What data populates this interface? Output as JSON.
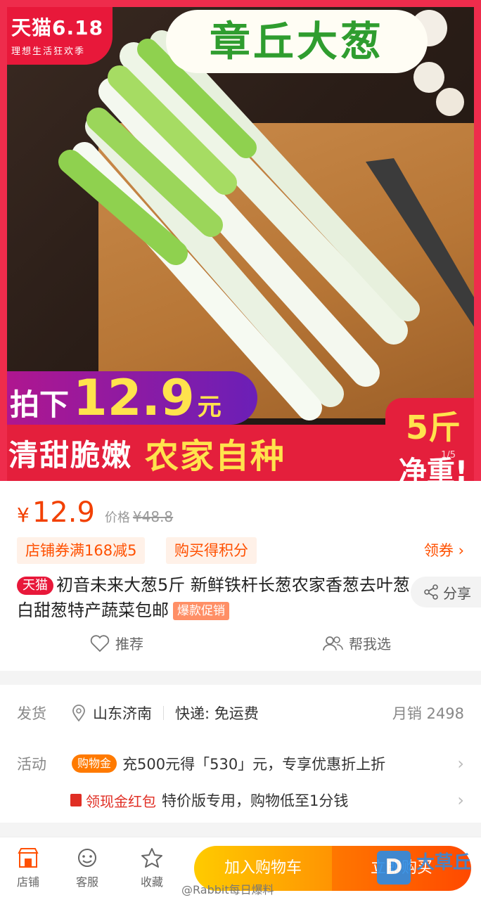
{
  "hero": {
    "badge_brand": "天猫6.18",
    "badge_tag": "理想生活狂欢季",
    "title": "章丘大葱",
    "price_prefix": "拍下",
    "price_value": "12.9",
    "price_unit": "元",
    "slogan_left": "清甜脆嫩",
    "slogan_right": "农家自种",
    "weight_line1": "5斤",
    "weight_line2": "净重!",
    "counter": "1/5"
  },
  "price": {
    "currency": "¥",
    "value": "12.9",
    "orig_label": "价格",
    "orig_value": "¥48.8"
  },
  "coupons": {
    "shop_coupon": "店铺券满168减5",
    "points": "购买得积分",
    "get_coupon": "领券 ›"
  },
  "product": {
    "tmall_tag": "天猫",
    "title": "初音未来大葱5斤 新鲜铁杆长葱农家香葱去叶葱白甜葱特产蔬菜包邮",
    "hot_tag": "爆款促销",
    "share_label": "分享"
  },
  "actions": {
    "recommend": "推荐",
    "help_choose": "帮我选"
  },
  "shipping": {
    "label": "发货",
    "location": "山东济南",
    "express": "快递: 免运费",
    "monthly_sales": "月销 2498"
  },
  "promotions": {
    "label": "活动",
    "gold_pill": "购物金",
    "gold_text": "充500元得「530」元，专享优惠折上折",
    "redpacket_pill": "领现金红包",
    "redpacket_text": "特价版专用，购物低至1分钱"
  },
  "bottom_bar": {
    "shop": "店铺",
    "service": "客服",
    "favorite": "收藏",
    "add_cart": "加入购物车",
    "buy_now": "立即购买"
  },
  "watermark": {
    "weibo": "@Rabbit每日爆料",
    "logo_letter": "D",
    "logo_text": "大草丘"
  },
  "colors": {
    "accent": "#ff5000",
    "tmall_red": "#e8183a",
    "cart_yellow": "#ffb000",
    "buy_orange": "#ff5a00"
  }
}
